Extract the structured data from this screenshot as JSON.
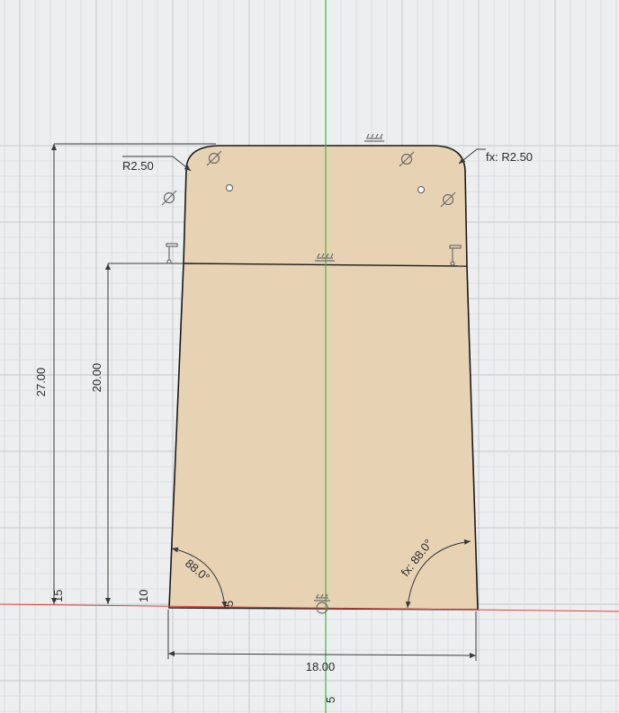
{
  "viewport": {
    "label": "CAD sketch canvas",
    "colors": {
      "background": "#eceeef",
      "profile_fill": "#e7d2b4",
      "profile_stroke": "#1a1a1a",
      "x_axis": "#e0403a",
      "y_axis": "#3cbb3c",
      "dimension": "#3a3a3a"
    }
  },
  "dimensions": {
    "top_left_radius": "R2.50",
    "top_right_radius": "fx: R2.50",
    "total_height": "27.00",
    "mid_height": "20.00",
    "bottom_width": "18.00",
    "left_angle": "88.0°",
    "right_angle": "fx: 88.0°"
  },
  "axis_labels": {
    "left_outer": "15",
    "left_inner": "10",
    "bottom_center": "5",
    "bottom_small": "5"
  },
  "constraints": [
    "tangent-icon",
    "tangent-icon",
    "tangent-icon",
    "tangent-icon",
    "horizontal-icon",
    "horizontal-icon",
    "coincident-icon",
    "coincident-icon",
    "midpoint-icon"
  ]
}
